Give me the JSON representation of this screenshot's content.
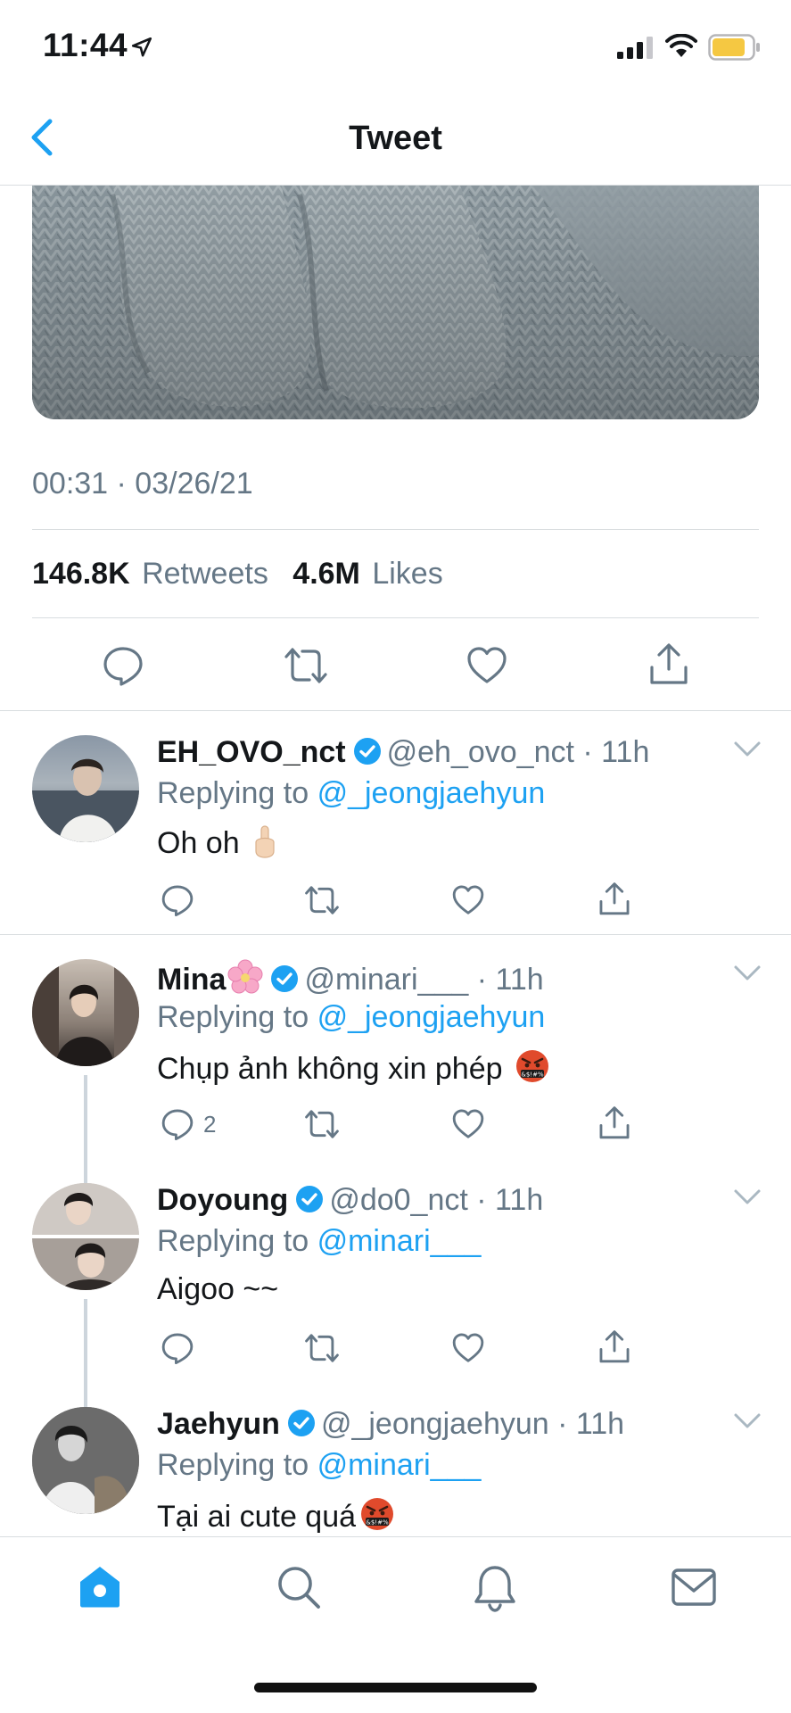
{
  "status_bar": {
    "time": "11:44",
    "battery_color": "#f5c842"
  },
  "nav": {
    "title": "Tweet"
  },
  "tweet": {
    "timestamp": "00:31 · 03/26/21",
    "retweets_count": "146.8K",
    "retweets_label": "Retweets",
    "likes_count": "4.6M",
    "likes_label": "Likes"
  },
  "replies": [
    {
      "name": "EH_OVO_nct",
      "handle": "@eh_ovo_nct",
      "time": "11h",
      "replying_prefix": "Replying to",
      "replying_to": "@_jeongjaehyun",
      "text": "Oh oh",
      "emoji": "raised-finger",
      "reply_count": ""
    },
    {
      "name": "Mina",
      "handle": "@minari___",
      "time": "11h",
      "replying_prefix": "Replying to",
      "replying_to": "@_jeongjaehyun",
      "text": "Chụp ảnh không xin phép",
      "emoji": "angry-cursing-face",
      "reply_count": "2"
    },
    {
      "name": "Doyoung",
      "handle": "@do0_nct",
      "time": "11h",
      "replying_prefix": "Replying to",
      "replying_to": "@minari___",
      "text": "Aigoo ~~",
      "emoji": "",
      "reply_count": ""
    },
    {
      "name": "Jaehyun",
      "handle": "@_jeongjaehyun",
      "time": "11h",
      "replying_prefix": "Replying to",
      "replying_to": "@minari___",
      "text": "Tại ai cute quá",
      "emoji": "angry-cursing-face",
      "reply_count": ""
    }
  ],
  "colors": {
    "accent": "#1da1f2",
    "secondary_text": "#657786",
    "verified": "#1da1f2"
  }
}
